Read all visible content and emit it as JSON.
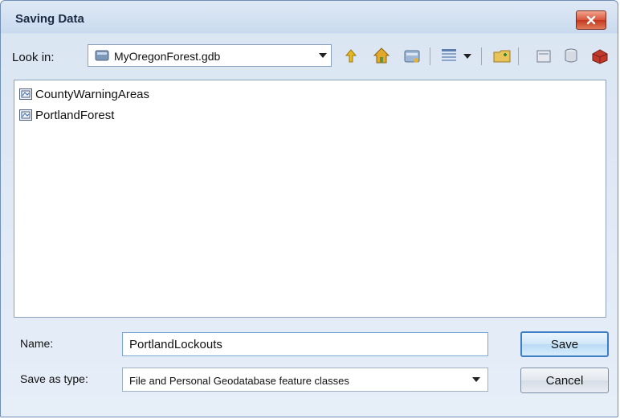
{
  "window": {
    "title": "Saving Data"
  },
  "toolbar": {
    "lookin_label": "Look in:",
    "location": "MyOregonForest.gdb",
    "icons": [
      "up-one-level-icon",
      "home-icon",
      "connect-folder-icon",
      "view-list-icon",
      "new-folder-icon",
      "new-file-geodatabase-icon",
      "new-personal-geodatabase-icon",
      "toolbox-icon"
    ]
  },
  "files": [
    {
      "name": "CountyWarningAreas",
      "icon": "feature-class-icon"
    },
    {
      "name": "PortlandForest",
      "icon": "feature-class-icon"
    }
  ],
  "form": {
    "name_label": "Name:",
    "name_value": "PortlandLockouts",
    "type_label": "Save as type:",
    "type_value": "File and Personal Geodatabase feature classes"
  },
  "buttons": {
    "save": "Save",
    "cancel": "Cancel"
  },
  "colors": {
    "close_button": "#d7533a",
    "default_button_border": "#3d7ec4"
  }
}
